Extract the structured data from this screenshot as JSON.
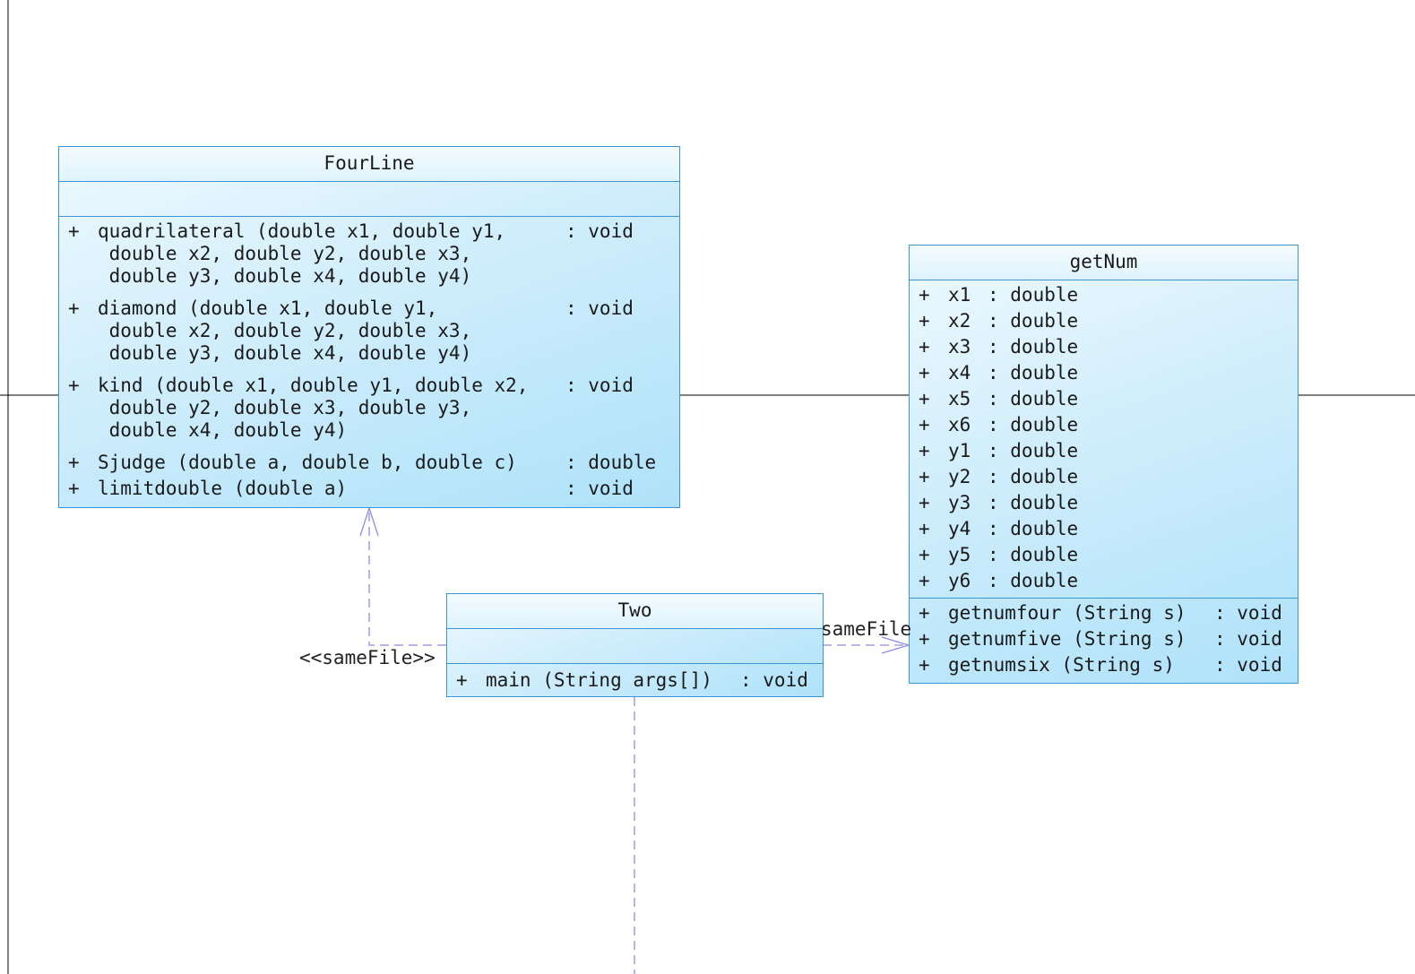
{
  "classes": {
    "fourline": {
      "name": "FourLine",
      "operations": [
        {
          "vis": "+",
          "lines": [
            "quadrilateral (double x1, double y1,",
            " double x2, double y2, double x3,",
            " double y3, double x4, double y4)"
          ],
          "ret": ": void"
        },
        {
          "vis": "+",
          "lines": [
            "diamond (double x1, double y1,",
            " double x2, double y2, double x3,",
            " double y3, double x4, double y4)"
          ],
          "ret": ": void"
        },
        {
          "vis": "+",
          "lines": [
            "kind (double x1, double y1, double x2,",
            " double y2, double x3, double y3,",
            " double x4, double y4)"
          ],
          "ret": ": void"
        },
        {
          "vis": "+",
          "lines": [
            "Sjudge (double a, double b, double c)"
          ],
          "ret": ": double"
        },
        {
          "vis": "+",
          "lines": [
            "limitdouble (double a)"
          ],
          "ret": ": void"
        }
      ]
    },
    "getnum": {
      "name": "getNum",
      "attributes": [
        {
          "vis": "+",
          "name": "x1",
          "type": ": double"
        },
        {
          "vis": "+",
          "name": "x2",
          "type": ": double"
        },
        {
          "vis": "+",
          "name": "x3",
          "type": ": double"
        },
        {
          "vis": "+",
          "name": "x4",
          "type": ": double"
        },
        {
          "vis": "+",
          "name": "x5",
          "type": ": double"
        },
        {
          "vis": "+",
          "name": "x6",
          "type": ": double"
        },
        {
          "vis": "+",
          "name": "y1",
          "type": ": double"
        },
        {
          "vis": "+",
          "name": "y2",
          "type": ": double"
        },
        {
          "vis": "+",
          "name": "y3",
          "type": ": double"
        },
        {
          "vis": "+",
          "name": "y4",
          "type": ": double"
        },
        {
          "vis": "+",
          "name": "y5",
          "type": ": double"
        },
        {
          "vis": "+",
          "name": "y6",
          "type": ": double"
        }
      ],
      "operations": [
        {
          "vis": "+",
          "sig": "getnumfour (String s)",
          "ret": ": void"
        },
        {
          "vis": "+",
          "sig": "getnumfive (String s)",
          "ret": ": void"
        },
        {
          "vis": "+",
          "sig": "getnumsix (String s)",
          "ret": ": void"
        }
      ]
    },
    "two": {
      "name": "Two",
      "operations": [
        {
          "vis": "+",
          "sig": "main (String args[])",
          "ret": ": void"
        }
      ]
    }
  },
  "relations": {
    "two_to_fourline": {
      "label": "<<sameFile>>",
      "color": "#8080e0"
    },
    "two_to_getnum": {
      "label": "sameFile",
      "color": "#8080e0"
    }
  }
}
